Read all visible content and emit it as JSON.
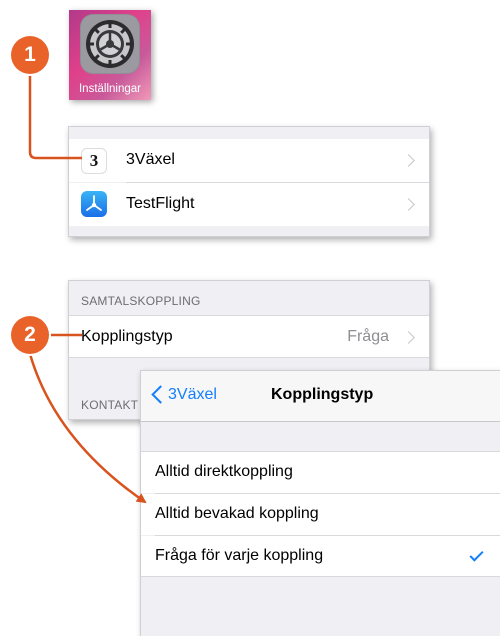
{
  "app_icon": {
    "label": "Inställningar",
    "icon": "gear-icon"
  },
  "badges": [
    "1",
    "2"
  ],
  "settings_list": {
    "items": [
      {
        "label": "3Växel",
        "icon": "three-logo-icon"
      },
      {
        "label": "TestFlight",
        "icon": "testflight-icon"
      }
    ]
  },
  "call_panel": {
    "section_header": "SAMTALSKOPPLING",
    "row_label": "Kopplingstyp",
    "row_value": "Fråga",
    "next_section_header": "KONTAKT"
  },
  "detail_screen": {
    "back_label": "3Växel",
    "title": "Kopplingstyp",
    "options": [
      {
        "label": "Alltid direktkoppling",
        "selected": false
      },
      {
        "label": "Alltid bevakad koppling",
        "selected": false
      },
      {
        "label": "Fråga för varje koppling",
        "selected": true
      }
    ]
  },
  "colors": {
    "accent": "#147efb",
    "badge": "#e8622a",
    "annotation_line": "#d9531e"
  }
}
